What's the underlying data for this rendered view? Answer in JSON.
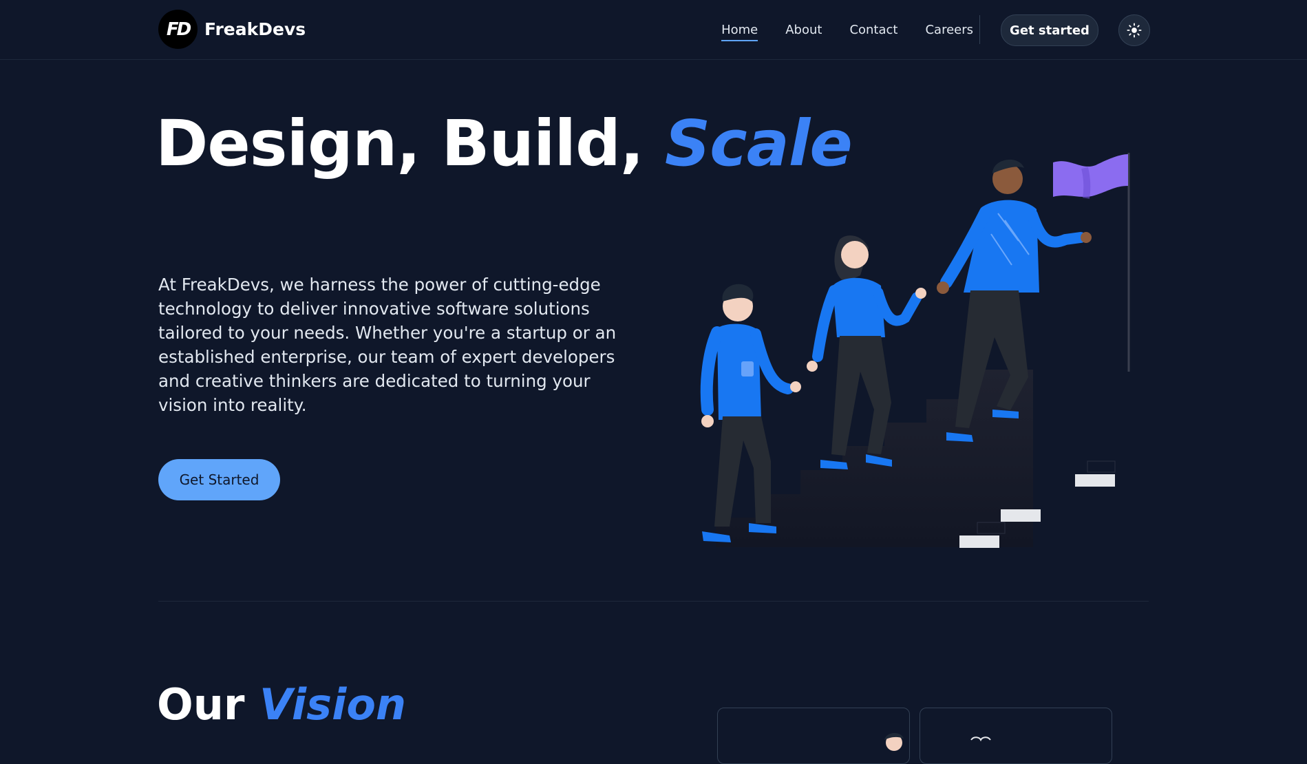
{
  "nav": {
    "logo_mark": "FD",
    "brand": "FreakDevs",
    "links": [
      "Home",
      "About",
      "Contact",
      "Careers"
    ],
    "active_link": "Home",
    "cta": "Get started"
  },
  "hero": {
    "title_plain": "Design, Build, ",
    "title_accent": "Scale",
    "description": "At FreakDevs, we harness the power of cutting-edge technology to deliver innovative software solutions tailored to your needs. Whether you're a startup or an established enterprise, our team of expert developers and creative thinkers are dedicated to turning your vision into reality.",
    "cta": "Get Started"
  },
  "vision": {
    "title_plain": "Our ",
    "title_accent": "Vision"
  },
  "colors": {
    "background": "#0f172a",
    "accent": "#3b82f6",
    "button": "#60a5fa",
    "shirt": "#1877f2",
    "flag": "#8b6cf0"
  },
  "icons": [
    "sun-icon",
    "freakdevs-logo"
  ]
}
